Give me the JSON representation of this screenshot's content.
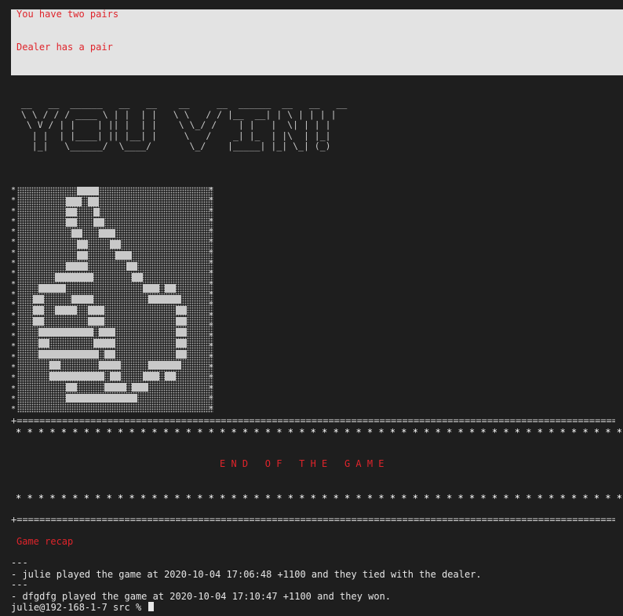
{
  "hand_messages": {
    "player": "You have two pairs",
    "dealer": "Dealer has a pair"
  },
  "banner_ascii": " __   __  ______   __   __    __     __  ______  __   __   __\n \\ \\ / / / ____ \\ | |  | |   \\ \\   / / |__  __| | \\ | | | |\n  \\ V / | |    | || |  | |    \\ \\_/ /    | |   |  \\| | | |\n   | |  | |____| || |__| |     \\   /    _| |_  | |\\  | |_|\n   |_|   \\______/  \\____/       \\_/    |_____| |_| \\_| (_)",
  "card_stars_left": "*\n*\n*\n*\n*\n*\n*\n*\n*\n*\n*\n*\n*\n*\n*\n*\n*\n*\n*\n*\n*\n*",
  "card_stars_right": "*\n*\n*\n*\n*\n*\n*\n*\n*\n*\n*\n*\n*\n*\n*\n*\n*\n*\n*\n*\n*\n*",
  "separator_line": "+==============================================================================================================+",
  "star_row": "* * * * * * * * * * * * * * * * * * * * * * * * * * * * * * * * * * * * * * * * * * * * * * * * * * * * * * * *",
  "end_title": "E N D   O F   T H E   G A M E",
  "recap_title": "Game recap",
  "recap_divider_1": "---",
  "recap_entry_1": "- julie played the game at 2020-10-04 17:06:48 +1100 and they tied with the dealer.",
  "recap_divider_2": "---",
  "recap_entry_2": "- dfgdfg played the game at 2020-10-04 17:10:47 +1100 and they won.",
  "prompt": "julie@192-168-1-7 src % ",
  "colors": {
    "background": "#1e1e1e",
    "accent_red": "#e0242b",
    "info_box": "#e3e3e3",
    "card_block": "#c9c9c9"
  }
}
